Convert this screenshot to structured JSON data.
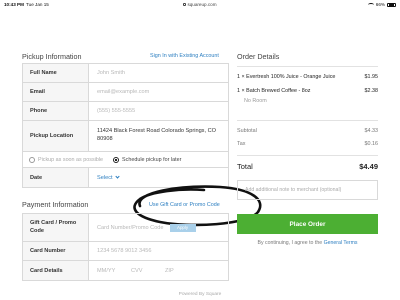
{
  "status_bar": {
    "time": "10:43 PM",
    "date": "Tue Jan 15",
    "url": "squareup.com",
    "battery": "66%"
  },
  "pickup": {
    "title": "Pickup Information",
    "signin_link": "Sign In with Existing Account",
    "fields": [
      {
        "label": "Full Name",
        "placeholder": "John Smith"
      },
      {
        "label": "Email",
        "placeholder": "email@example.com"
      },
      {
        "label": "Phone",
        "placeholder": "(555) 555-5555"
      }
    ],
    "location_label": "Pickup Location",
    "location_value": "11424 Black Forest Road Colorado Springs, CO 80908",
    "option_asap": "Pickup as soon as possible",
    "option_schedule": "Schedule pickup for later",
    "date_label": "Date",
    "date_value": "Select"
  },
  "payment": {
    "title": "Payment Information",
    "promo_link": "Use Gift Card or Promo Code",
    "gift_label": "Gift Card / Promo Code",
    "gift_placeholder": "Card Number/Promo Code",
    "apply_label": "Apply",
    "card_number_label": "Card Number",
    "card_number_placeholder": "1234 5678 9012 3456",
    "card_details_label": "Card Details",
    "mm_yy": "MM/YY",
    "cvv": "CVV",
    "zip": "ZIP"
  },
  "order": {
    "title": "Order Details",
    "items": [
      {
        "name": "1 × Evertresh 100% Juice - Orange Juice",
        "price": "$1.95",
        "note": ""
      },
      {
        "name": "1 × Batch Brewed Coffee - 8oz",
        "price": "$2.38",
        "note": "No Room"
      }
    ],
    "subtotal_label": "Subtotal",
    "subtotal": "$4.33",
    "tax_label": "Tax",
    "tax": "$0.16",
    "total_label": "Total",
    "total": "$4.49",
    "note_placeholder": "Add additional note to merchant (optional)",
    "place_order": "Place Order",
    "terms_prefix": "By continuing, I agree to the",
    "terms_link": "General Terms"
  },
  "footer": "Powered By Square",
  "colors": {
    "accent": "#2d7fc1",
    "button": "#4caf33"
  }
}
